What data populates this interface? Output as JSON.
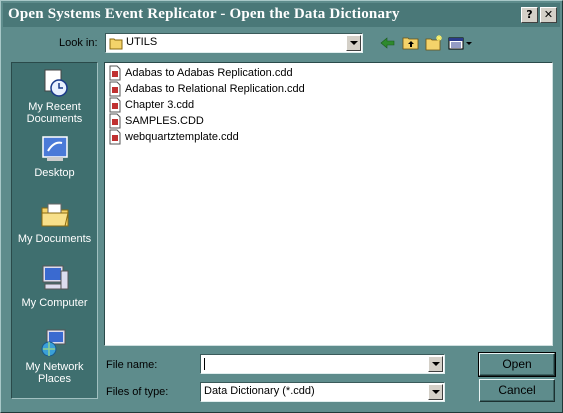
{
  "window": {
    "title": "Open Systems Event Replicator - Open the Data Dictionary",
    "help_button": "?",
    "close_button": "✕"
  },
  "lookin": {
    "label": "Look in:",
    "value": "UTILS"
  },
  "toolbar": {
    "icons": [
      "back-icon",
      "up-folder-icon",
      "new-folder-icon",
      "view-menu-icon"
    ]
  },
  "places": [
    {
      "label": "My Recent Documents",
      "icon": "recent-documents-icon"
    },
    {
      "label": "Desktop",
      "icon": "desktop-icon"
    },
    {
      "label": "My Documents",
      "icon": "my-documents-icon"
    },
    {
      "label": "My Computer",
      "icon": "my-computer-icon"
    },
    {
      "label": "My Network Places",
      "icon": "network-places-icon"
    }
  ],
  "files": [
    "Adabas to Adabas Replication.cdd",
    "Adabas to Relational Replication.cdd",
    "Chapter 3.cdd",
    "SAMPLES.CDD",
    "webquartztemplate.cdd"
  ],
  "filename": {
    "label": "File name:",
    "value": ""
  },
  "filetype": {
    "label": "Files of type:",
    "value": "Data Dictionary (*.cdd)"
  },
  "buttons": {
    "open": "Open",
    "cancel": "Cancel"
  },
  "colors": {
    "dialog_bg": "#5e8c8c",
    "places_bg": "#3f6f6f",
    "title_text": "#ffffff"
  }
}
